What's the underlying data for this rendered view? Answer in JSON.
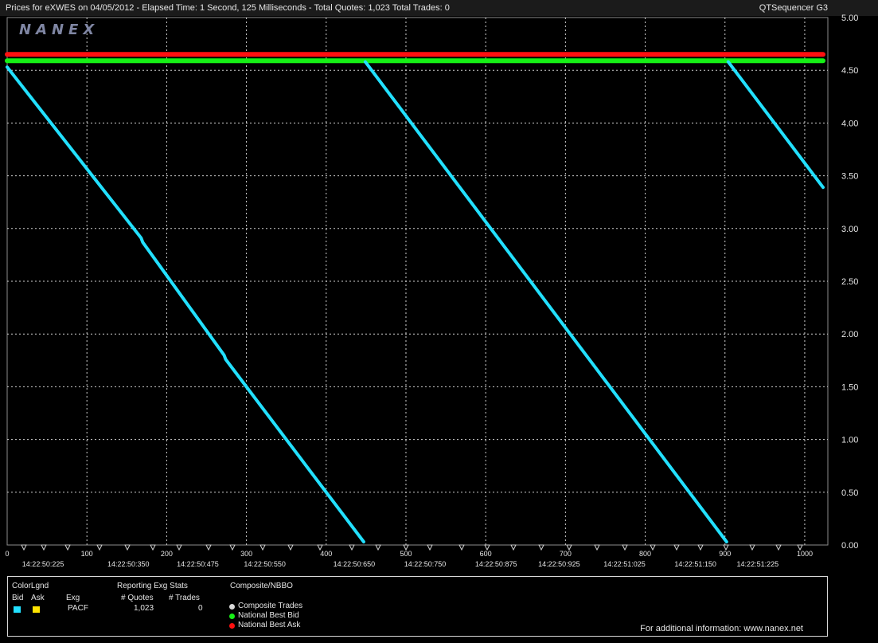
{
  "header": {
    "title": "Prices for  eXWES  on  04/05/2012  -  Elapsed Time: 1 Second, 125 Milliseconds  -  Total Quotes: 1,023  Total Trades: 0",
    "app": "QTSequencer G3"
  },
  "logo": "NANEX",
  "legend": {
    "colorlgnd_label": "ColorLgnd",
    "bid_label": "Bid",
    "ask_label": "Ask",
    "exg_label": "Exg",
    "exchange": "PACF",
    "stats_title": "Reporting Exg Stats",
    "quotes_label": "# Quotes",
    "trades_label": "# Trades",
    "quotes_value": "1,023",
    "trades_value": "0",
    "composite_title": "Composite/NBBO",
    "items": [
      "Composite Trades",
      "National Best Bid",
      "National Best Ask"
    ],
    "colors": {
      "bid": "#22e0ff",
      "ask": "#ffe400",
      "composite": "#d9d9d9",
      "nbb": "#16f016",
      "nba": "#ff1010"
    }
  },
  "footer": {
    "info": "For additional information: www.nanex.net"
  },
  "chart_data": {
    "type": "line",
    "ylim": [
      0,
      5.0
    ],
    "xlim": [
      0,
      1023
    ],
    "y_ticks": [
      "0.00",
      "0.50",
      "1.00",
      "1.50",
      "2.00",
      "2.50",
      "3.00",
      "3.50",
      "4.00",
      "4.50",
      "5.00"
    ],
    "x_ticks": [
      0,
      100,
      200,
      300,
      400,
      500,
      600,
      700,
      800,
      900,
      1000
    ],
    "time_labels": [
      {
        "x": 45,
        "label": "14:22:50:225"
      },
      {
        "x": 152,
        "label": "14:22:50:350"
      },
      {
        "x": 239,
        "label": "14:22:50:475"
      },
      {
        "x": 323,
        "label": "14:22:50:550"
      },
      {
        "x": 435,
        "label": "14:22:50:650"
      },
      {
        "x": 524,
        "label": "14:22:50:750"
      },
      {
        "x": 613,
        "label": "14:22:50:875"
      },
      {
        "x": 692,
        "label": "14:22:50:925"
      },
      {
        "x": 774,
        "label": "14:22:51:025"
      },
      {
        "x": 863,
        "label": "14:22:51:150"
      },
      {
        "x": 941,
        "label": "14:22:51:225"
      }
    ],
    "series": [
      {
        "name": "National Best Ask",
        "color": "#ff1010",
        "x": [
          0,
          1023
        ],
        "y": [
          4.65,
          4.65
        ]
      },
      {
        "name": "National Best Bid",
        "color": "#16f016",
        "x": [
          0,
          1023
        ],
        "y": [
          4.59,
          4.59
        ]
      },
      {
        "name": "Bid",
        "color": "#22e0ff",
        "segments": [
          {
            "x": [
              0,
              168,
              170,
              272,
              274,
              447
            ],
            "y": [
              4.53,
              2.91,
              2.87,
              1.8,
              1.76,
              0.03
            ]
          },
          {
            "x": [
              449,
              902
            ],
            "y": [
              4.58,
              0.03
            ]
          },
          {
            "x": [
              904,
              1023
            ],
            "y": [
              4.58,
              3.39
            ]
          }
        ]
      }
    ]
  }
}
